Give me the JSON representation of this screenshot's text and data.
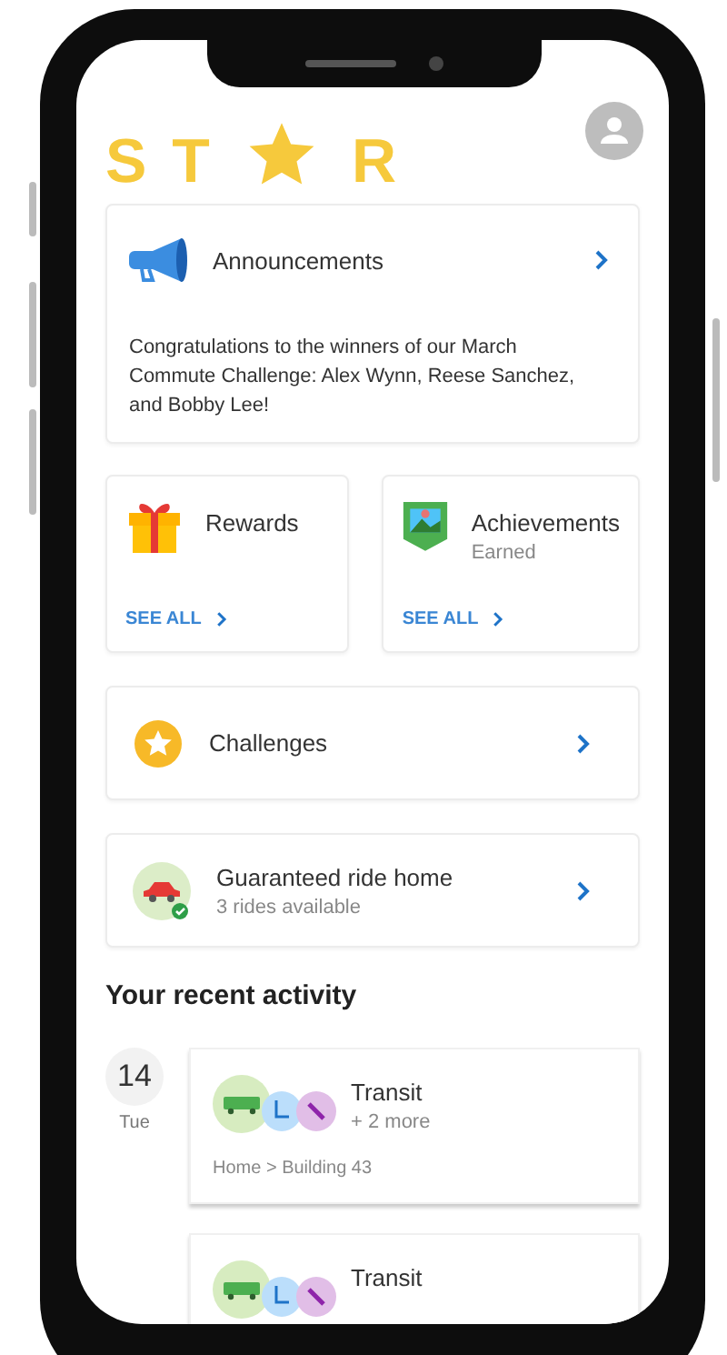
{
  "logo": {
    "before": "ST",
    "after": "R"
  },
  "announcement": {
    "title": "Announcements",
    "message": "Congratulations to the winners of our March Commute Challenge: Alex Wynn, Reese Sanchez, and Bobby Lee!"
  },
  "tiles": [
    {
      "kind": "rewards",
      "title": "Rewards",
      "link": "SEE ALL"
    },
    {
      "kind": "achievements",
      "title": "Achievements",
      "subtitle": "Earned",
      "link": "SEE ALL"
    }
  ],
  "rows": [
    {
      "kind": "challenges",
      "title": "Challenges"
    },
    {
      "kind": "ride",
      "title": "Guaranteed ride home",
      "subtitle": "3 rides available"
    }
  ],
  "activity": {
    "heading": "Your recent activity",
    "entries": [
      {
        "day": "14",
        "weekday": "Tue",
        "title": "Transit",
        "more": "+ 2 more",
        "route": "Home > Building 43"
      },
      {
        "title": "Transit"
      }
    ]
  }
}
